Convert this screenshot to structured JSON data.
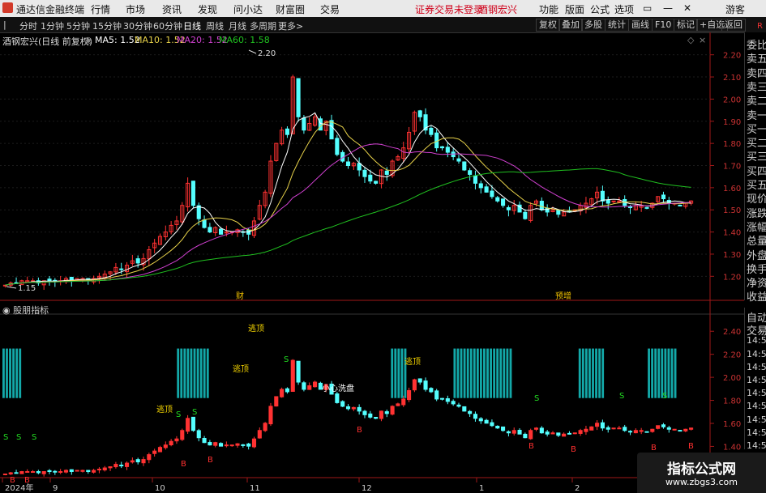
{
  "window": {
    "title": "通达信金融终端",
    "status": "证券交易未登录",
    "stock_tab": "酒钢宏兴",
    "user": "游客"
  },
  "menus": [
    "行情",
    "市场",
    "资讯",
    "发现",
    "问小达",
    "财富圈",
    "交易"
  ],
  "right_menus": [
    "功能",
    "版面",
    "公式",
    "选项"
  ],
  "period_tabs": [
    "分时",
    "1分钟",
    "5分钟",
    "15分钟",
    "30分钟",
    "60分钟",
    "日线",
    "周线",
    "月线",
    "多周期",
    "更多>"
  ],
  "active_period": "日线",
  "toolbar_right": [
    "复权",
    "叠加",
    "多股",
    "统计",
    "画线",
    "F10",
    "标记",
    "+自选",
    "返回"
  ],
  "main_chart": {
    "stock_label": "酒钢宏兴(日线 前复权)",
    "ma": [
      {
        "label": "MA5: 1.52",
        "color": "#ffffff"
      },
      {
        "label": "MA10: 1.52",
        "color": "#e8d24a"
      },
      {
        "label": "MA20: 1.52",
        "color": "#d040d0"
      },
      {
        "label": "MA60: 1.58",
        "color": "#20c020"
      }
    ],
    "high_label": "2.20",
    "low_label": "1.15",
    "event_labels": [
      "财",
      "预增"
    ],
    "y_ticks": [
      "2.20",
      "2.10",
      "2.00",
      "1.90",
      "1.80",
      "1.70",
      "1.60",
      "1.50",
      "1.40",
      "1.30",
      "1.20"
    ]
  },
  "indicator": {
    "title": "股朋指标",
    "y_ticks": [
      "2.40",
      "2.20",
      "2.00",
      "1.80",
      "1.60",
      "1.40",
      "1.20"
    ],
    "labels": [
      "逃顶",
      "逃顶",
      "逃顶",
      "逃顶",
      "小心洗盘"
    ],
    "buy_label": "B",
    "sell_label": "S"
  },
  "x_axis": [
    "2024年",
    "9",
    "10",
    "11",
    "12",
    "1",
    "2"
  ],
  "side_panel": [
    "委比",
    "卖五",
    "卖四",
    "卖三",
    "卖二",
    "卖一",
    "买一",
    "买二",
    "买三",
    "买四",
    "买五",
    "现价",
    "涨跌",
    "涨幅",
    "总量",
    "外盘",
    "换手",
    "净资",
    "收益"
  ],
  "side_panel_lower": [
    "自动",
    "交易",
    "14:56",
    "14:56",
    "14:56",
    "14:56",
    "14:56",
    "14:56",
    "14:56",
    "14:56",
    "14:56",
    "14:56"
  ],
  "side_top_label": "R",
  "watermark": {
    "line1": "指标公式网",
    "line2": "www.zbgs3.com"
  },
  "chart_data": [
    {
      "type": "candlestick",
      "title": "酒钢宏兴(日线 前复权)",
      "x_labels": [
        "2024年",
        "9",
        "10",
        "11",
        "12",
        "1",
        "2"
      ],
      "ylim": [
        1.15,
        2.25
      ],
      "y_ticks": [
        1.2,
        1.3,
        1.4,
        1.5,
        1.6,
        1.7,
        1.8,
        1.9,
        2.0,
        2.1,
        2.2
      ],
      "close": [
        1.16,
        1.17,
        1.17,
        1.18,
        1.18,
        1.18,
        1.17,
        1.18,
        1.18,
        1.18,
        1.18,
        1.19,
        1.18,
        1.19,
        1.19,
        1.18,
        1.19,
        1.2,
        1.21,
        1.22,
        1.24,
        1.23,
        1.25,
        1.27,
        1.26,
        1.28,
        1.32,
        1.35,
        1.38,
        1.4,
        1.43,
        1.45,
        1.52,
        1.62,
        1.52,
        1.46,
        1.42,
        1.4,
        1.42,
        1.39,
        1.4,
        1.4,
        1.41,
        1.4,
        1.39,
        1.45,
        1.52,
        1.58,
        1.72,
        1.8,
        1.86,
        1.84,
        2.1,
        1.92,
        1.86,
        1.89,
        1.92,
        1.86,
        1.9,
        1.82,
        1.75,
        1.72,
        1.7,
        1.71,
        1.68,
        1.65,
        1.63,
        1.62,
        1.68,
        1.66,
        1.72,
        1.74,
        1.78,
        1.85,
        1.94,
        1.92,
        1.86,
        1.84,
        1.78,
        1.78,
        1.76,
        1.74,
        1.72,
        1.68,
        1.66,
        1.62,
        1.6,
        1.58,
        1.56,
        1.54,
        1.52,
        1.5,
        1.52,
        1.49,
        1.46,
        1.52,
        1.54,
        1.5,
        1.49,
        1.5,
        1.48,
        1.49,
        1.49,
        1.5,
        1.52,
        1.53,
        1.55,
        1.58,
        1.54,
        1.53,
        1.54,
        1.54,
        1.52,
        1.51,
        1.52,
        1.52,
        1.51,
        1.53,
        1.56,
        1.55,
        1.53,
        1.53,
        1.52,
        1.53,
        1.54
      ],
      "ma_series": [
        {
          "name": "MA5",
          "last": 1.52,
          "color": "#ffffff"
        },
        {
          "name": "MA10",
          "last": 1.52,
          "color": "#e8d24a"
        },
        {
          "name": "MA20",
          "last": 1.52,
          "color": "#d040d0"
        },
        {
          "name": "MA60",
          "last": 1.58,
          "color": "#20c020"
        }
      ],
      "annotations": [
        {
          "text": "2.20",
          "kind": "high"
        },
        {
          "text": "1.15",
          "kind": "low"
        }
      ]
    },
    {
      "type": "bar",
      "title": "股朋指标",
      "ylim": [
        1.15,
        2.5
      ],
      "y_ticks": [
        1.2,
        1.4,
        1.6,
        1.8,
        2.0,
        2.2,
        2.4
      ],
      "signal_bar_ranges": [
        [
          0,
          1
        ],
        [
          2,
          3
        ],
        [
          4,
          5
        ],
        [
          53,
          62
        ],
        [
          118,
          122
        ],
        [
          137,
          151
        ],
        [
          152,
          154
        ],
        [
          175,
          182
        ],
        [
          196,
          204
        ]
      ],
      "annotations": [
        "逃顶",
        "逃顶",
        "逃顶",
        "逃顶",
        "小心洗盘",
        "B",
        "S"
      ]
    }
  ]
}
